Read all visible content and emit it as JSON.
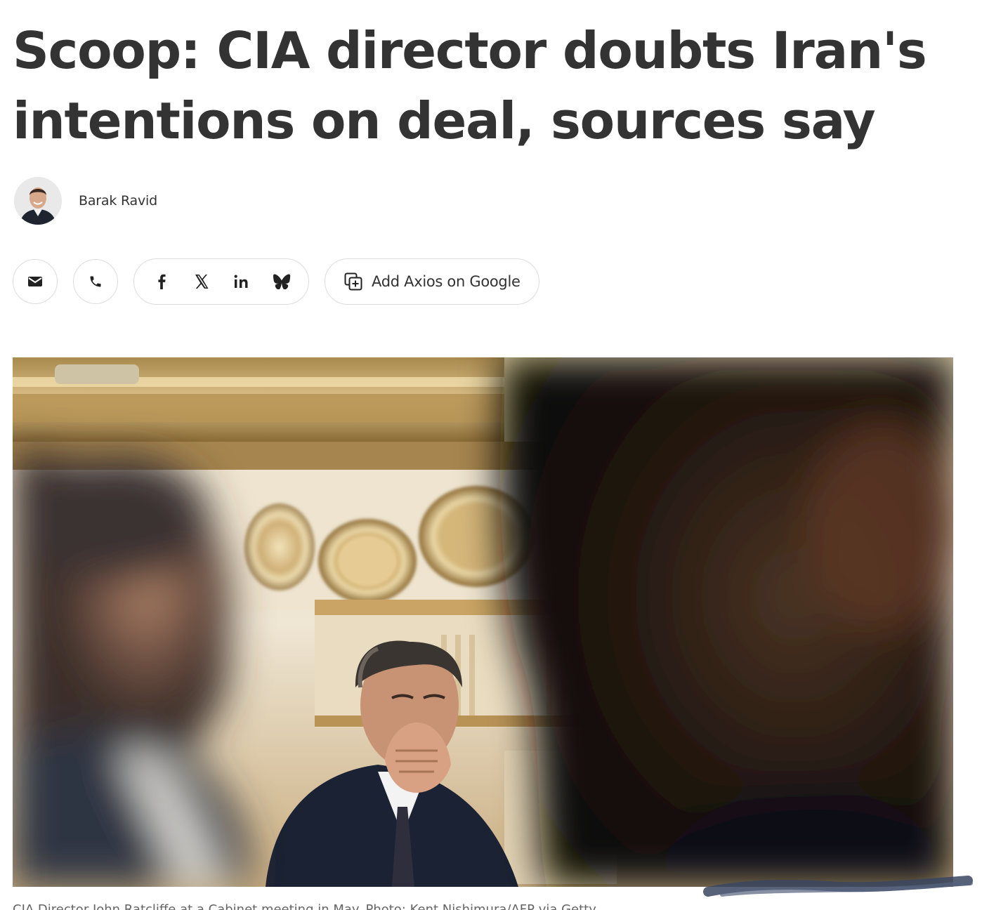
{
  "article": {
    "headline": "Scoop: CIA director doubts Iran's intentions on deal, sources say",
    "author": {
      "name": "Barak Ravid"
    },
    "share": {
      "email_icon": "mail-icon",
      "phone_icon": "phone-icon",
      "social_icons": [
        "facebook-icon",
        "x-icon",
        "linkedin-icon",
        "bluesky-icon"
      ],
      "add_google_label": "Add Axios on Google",
      "add_google_icon": "add-source-icon"
    },
    "hero_image": {
      "caption": "CIA Director John Ratcliffe at a Cabinet meeting in May. Photo: Kent Nishimura/AFP via Getty"
    }
  },
  "colors": {
    "text": "#333333",
    "border": "#dddddd",
    "caption": "#666666",
    "background": "#ffffff"
  }
}
